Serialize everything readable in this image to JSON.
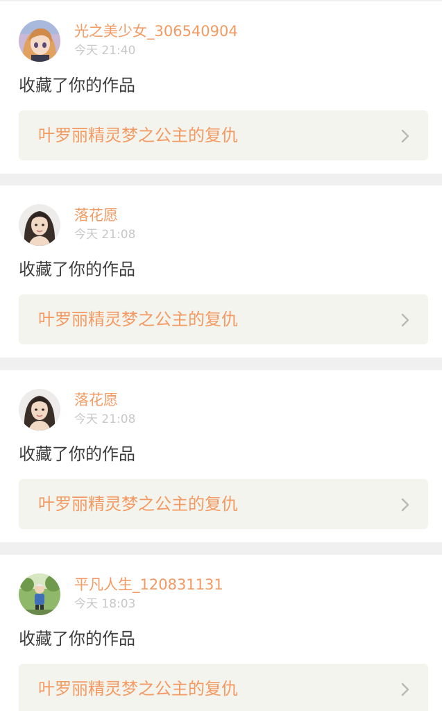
{
  "notifications": [
    {
      "username": "光之美少女_306540904",
      "time": "今天 21:40",
      "action": "收藏了你的作品",
      "work_title": "叶罗丽精灵梦之公主的复仇",
      "avatar_icon": "anime-girl-avatar"
    },
    {
      "username": "落花愿",
      "time": "今天 21:08",
      "action": "收藏了你的作品",
      "work_title": "叶罗丽精灵梦之公主的复仇",
      "avatar_icon": "portrait-woman-avatar"
    },
    {
      "username": "落花愿",
      "time": "今天 21:08",
      "action": "收藏了你的作品",
      "work_title": "叶罗丽精灵梦之公主的复仇",
      "avatar_icon": "portrait-woman-avatar"
    },
    {
      "username": "平凡人生_120831131",
      "time": "今天 18:03",
      "action": "收藏了你的作品",
      "work_title": "叶罗丽精灵梦之公主的复仇",
      "avatar_icon": "child-outdoors-avatar"
    }
  ],
  "colors": {
    "accent": "#f39a63",
    "time": "#c8c8c8",
    "action_text": "#3c3c3c",
    "link_background": "#f4f4ee",
    "page_background": "#f0f0f0"
  }
}
